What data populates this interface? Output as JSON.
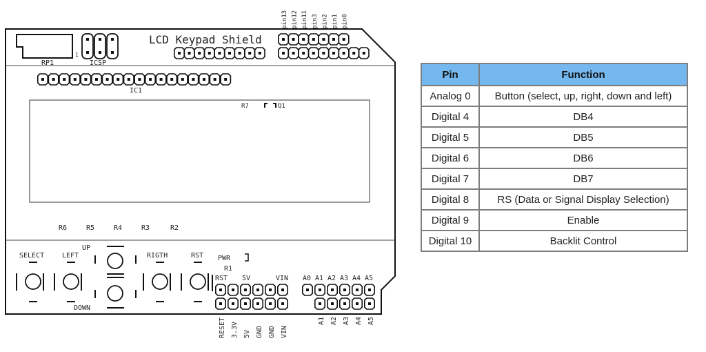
{
  "board": {
    "title": "LCD Keypad Shield",
    "labels": {
      "rp1": "RP1",
      "icsp": "ICSP",
      "icsp_pin1": "1",
      "ic1": "IC1",
      "r7": "R7",
      "q1": "Q1",
      "r6": "R6",
      "r5": "R5",
      "r4": "R4",
      "r3": "R3",
      "r2": "R2",
      "pwr": "PWR",
      "r1": "R1",
      "rst_top": "RST",
      "fivev_top": "5V",
      "vin_top": "VIN"
    },
    "buttons": {
      "select": "SELECT",
      "left": "LEFT",
      "up": "UP",
      "down": "DOWN",
      "right": "RIGTH",
      "rst": "RST"
    },
    "digital_pin_labels": [
      "pin13",
      "pin12",
      "pin11",
      "pin3",
      "pin2",
      "pin1",
      "pin0"
    ],
    "analog_top_labels": [
      "A0",
      "A1",
      "A2",
      "A3",
      "A4",
      "A5"
    ],
    "power_bottom_labels": [
      "RESET",
      "3.3V",
      "5V",
      "GND",
      "GND",
      "VIN"
    ],
    "analog_bottom_labels": [
      "A1",
      "A2",
      "A3",
      "A4",
      "A5"
    ]
  },
  "table": {
    "headers": [
      "Pin",
      "Function"
    ],
    "rows": [
      [
        "Analog 0",
        "Button (select, up, right, down and left)"
      ],
      [
        "Digital 4",
        "DB4"
      ],
      [
        "Digital 5",
        "DB5"
      ],
      [
        "Digital 6",
        "DB6"
      ],
      [
        "Digital 7",
        "DB7"
      ],
      [
        "Digital 8",
        "RS (Data or Signal Display Selection)"
      ],
      [
        "Digital 9",
        "Enable"
      ],
      [
        "Digital 10",
        "Backlit Control"
      ]
    ],
    "header_color": "#74b8ef",
    "border_color": "#7d7d7d"
  }
}
